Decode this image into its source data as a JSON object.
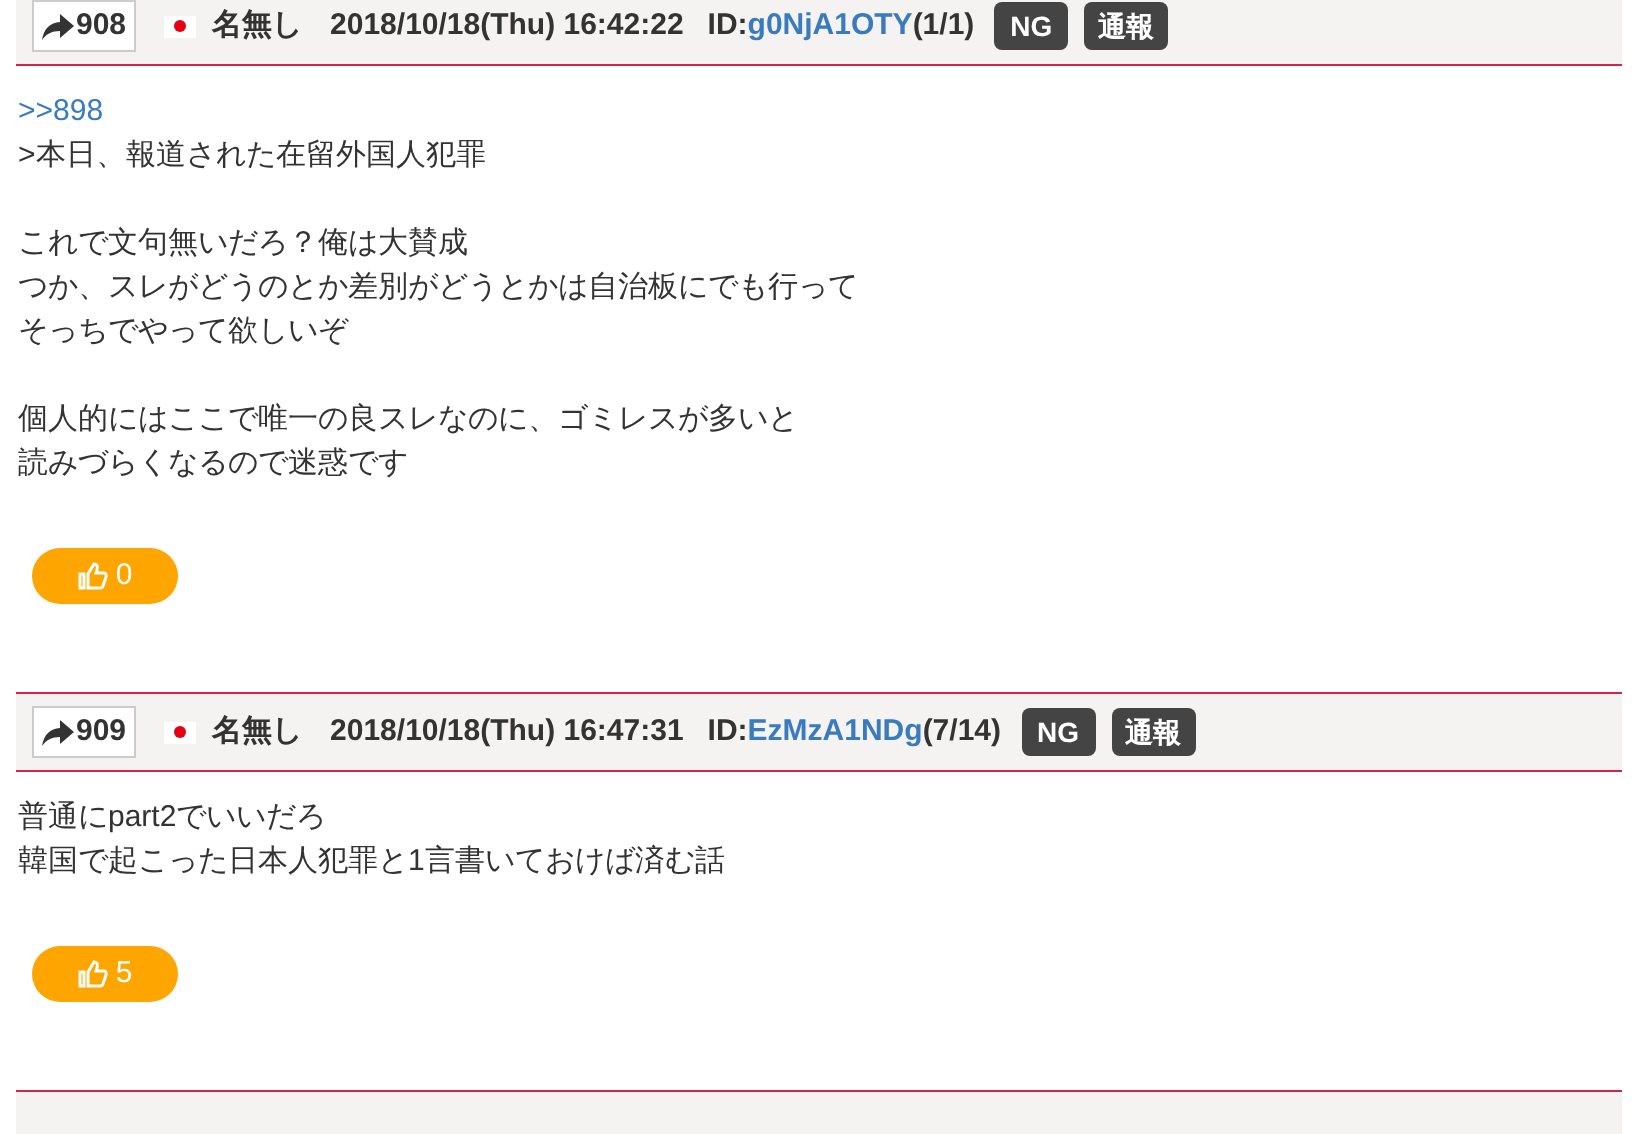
{
  "posts": [
    {
      "number": "908",
      "name": "名無し",
      "date": "2018/10/18(Thu) 16:42:22",
      "id_label": "ID:",
      "id": "g0NjA1OTY",
      "count": "(1/1)",
      "ng": "NG",
      "report": "通報",
      "anchor": ">>898",
      "paragraphs": [
        [
          ">本日、報道された在留外国人犯罪"
        ],
        [
          "これで文句無いだろ？俺は大賛成",
          "つか、スレがどうのとか差別がどうとかは自治板にでも行って",
          "そっちでやって欲しいぞ"
        ],
        [
          "個人的にはここで唯一の良スレなのに、ゴミレスが多いと",
          "読みづらくなるので迷惑です"
        ]
      ],
      "likes": "0"
    },
    {
      "number": "909",
      "name": "名無し",
      "date": "2018/10/18(Thu) 16:47:31",
      "id_label": "ID:",
      "id": "EzMzA1NDg",
      "count": "(7/14)",
      "ng": "NG",
      "report": "通報",
      "paragraphs": [
        [
          "普通にpart2でいいだろ",
          "韓国で起こった日本人犯罪と1言書いておけば済む話"
        ]
      ],
      "likes": "5"
    }
  ]
}
